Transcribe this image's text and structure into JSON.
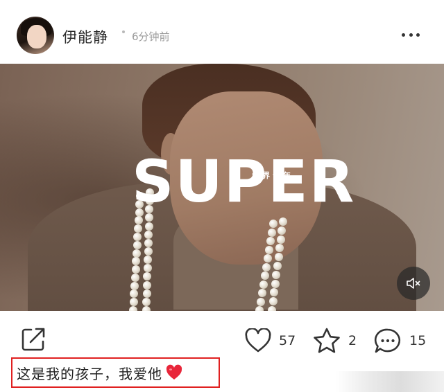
{
  "post": {
    "author": "伊能静",
    "time": "6分钟前",
    "caption": "这是我的孩子，我爱他"
  },
  "media": {
    "logo_text": "SUPER",
    "logo_sub": "世界青年",
    "muted": true
  },
  "actions": {
    "likes": "57",
    "favorites": "2",
    "comments": "15"
  },
  "colors": {
    "highlight_border": "#e02020",
    "heart_emoji": "#e8263a"
  }
}
